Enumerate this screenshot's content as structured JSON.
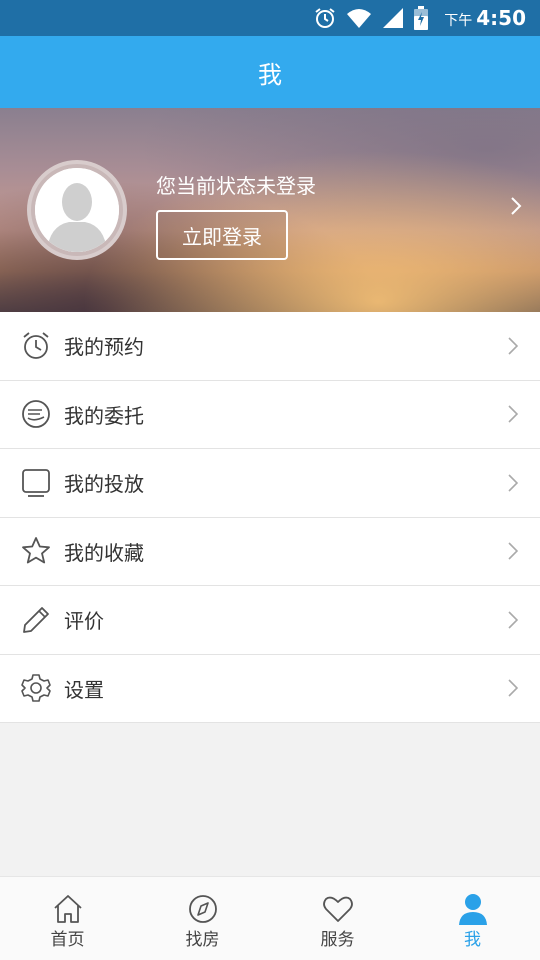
{
  "status_bar": {
    "ampm": "下午",
    "time": "4:50",
    "icons": [
      "alarm-icon",
      "wifi-icon",
      "signal-icon",
      "battery-icon"
    ]
  },
  "header": {
    "title": "我"
  },
  "profile": {
    "status_text": "您当前状态未登录",
    "login_button": "立即登录"
  },
  "menu": [
    {
      "label": "我的预约",
      "icon": "alarm-clock-icon"
    },
    {
      "label": "我的委托",
      "icon": "handshake-icon"
    },
    {
      "label": "我的投放",
      "icon": "monitor-icon"
    },
    {
      "label": "我的收藏",
      "icon": "star-icon"
    },
    {
      "label": "评价",
      "icon": "pencil-icon"
    },
    {
      "label": "设置",
      "icon": "gear-icon"
    }
  ],
  "bottom_nav": [
    {
      "label": "首页",
      "icon": "home-icon",
      "active": false
    },
    {
      "label": "找房",
      "icon": "compass-icon",
      "active": false
    },
    {
      "label": "服务",
      "icon": "heart-icon",
      "active": false
    },
    {
      "label": "我",
      "icon": "person-icon",
      "active": true
    }
  ],
  "colors": {
    "accent": "#33aaee",
    "status_bar": "#1f6fa6",
    "active_nav": "#2aa1e8"
  }
}
